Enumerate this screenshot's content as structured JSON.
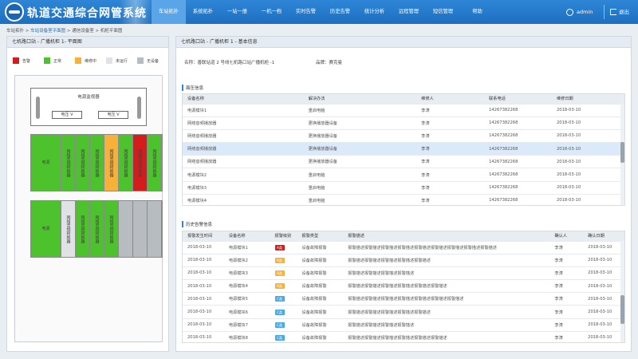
{
  "app": {
    "title": "轨道交通综合网管系统"
  },
  "nav": {
    "items": [
      "车站拓扑",
      "系统拓扑",
      "一站一册",
      "一机一档",
      "实时告警",
      "历史告警",
      "统计分析",
      "远程管理",
      "短信管理",
      "帮助"
    ],
    "active": 0,
    "user": "admin",
    "logout": "退出"
  },
  "breadcrumb": {
    "a": "车站拓扑",
    "b": "车站设备室平面图",
    "c": "通信设备室",
    "d": "机柜平面图",
    "sep": " > "
  },
  "left": {
    "title": "七机路口站 - 广播机柜 1- 平面图",
    "legend": [
      {
        "label": "告警",
        "color": "#d31c1c"
      },
      {
        "label": "正常",
        "color": "#4cc22c"
      },
      {
        "label": "维修中",
        "color": "#f5b13a"
      },
      {
        "label": "未运行",
        "color": "#dfe3e6"
      },
      {
        "label": "无设备",
        "color": "#b7bcc1"
      }
    ],
    "ps": {
      "title": "电源监视器",
      "v1": "电压 V",
      "v2": "电压 V"
    },
    "row1": {
      "first": "电源",
      "cells": [
        {
          "t": "网络音频转换器",
          "c": "g"
        },
        {
          "t": "网络音频转换器",
          "c": "g"
        },
        {
          "t": "网络音频转换器",
          "c": "g"
        },
        {
          "t": "网络音频转换器",
          "c": "y"
        },
        {
          "t": "网络音频转换器",
          "c": "g"
        },
        {
          "t": "网络音频转换器",
          "c": "r"
        },
        {
          "t": "网络音频转换器",
          "c": "g"
        }
      ]
    },
    "row2": {
      "first": "电源",
      "cells": [
        {
          "t": "网络音频转换器",
          "c": "wht"
        },
        {
          "t": "网络音频转换器",
          "c": "g"
        },
        {
          "t": "网络音频转换器",
          "c": "g"
        },
        {
          "t": "网络音频转换器",
          "c": "g"
        },
        {
          "t": "",
          "c": "gy"
        },
        {
          "t": "",
          "c": "gy"
        },
        {
          "t": "",
          "c": "gy"
        }
      ]
    }
  },
  "right": {
    "title": "七机路口站 - 广播机柜 1 - 基本信息",
    "location": "名称：善联站道 2 号线七机路口站广播机柜 -1",
    "brand": "品牌：赛克曼",
    "maint": {
      "section": "面压信息",
      "headers": [
        "设备名称",
        "解决办法",
        "维修人",
        "联系电话",
        "维修日期"
      ],
      "rows": [
        [
          "电源模块1",
          "重启电脑",
          "李涛",
          "14267382268",
          "2018-03-10"
        ],
        [
          "网络音频播放器",
          "更换播放器设备",
          "李涛",
          "14267382268",
          "2018-03-10"
        ],
        [
          "网络音频播放器",
          "更换播放器设备",
          "李涛",
          "14267382268",
          "2018-03-10"
        ],
        [
          "网络音频播放器",
          "更换播放器设备",
          "李涛",
          "14267382268",
          "2018-03-10"
        ],
        [
          "网络音频播放器",
          "更换播放器设备",
          "李涛",
          "14267382268",
          "2018-03-10"
        ],
        [
          "电源模块2",
          "重启电脑",
          "李涛",
          "14267382268",
          "2018-03-10"
        ],
        [
          "电源模块3",
          "重启电脑",
          "李涛",
          "14267382268",
          "2018-03-10"
        ],
        [
          "电源模块4",
          "重启电脑",
          "李涛",
          "14267382268",
          "2018-03-10"
        ]
      ]
    },
    "alarm": {
      "section": "历史告警信息",
      "headers": [
        "报警发生时间",
        "设备名称",
        "报警级别",
        "报警类型",
        "报警描述",
        "确认人",
        "确认日期"
      ],
      "rows": [
        [
          "2018-03-10",
          "电源模块1",
          "A类",
          "设备故障报警",
          "报警描述报警描述报警描述报警描述报警描述报警描述报警描述报警描述报警描述",
          "李涛",
          "2018-03-10"
        ],
        [
          "2018-03-10",
          "电源模块2",
          "B类",
          "设备故障报警",
          "报警描述报警描述报警描述报警描述报警描述",
          "李涛",
          "2018-03-10"
        ],
        [
          "2018-03-10",
          "电源模块3",
          "B类",
          "设备故障报警",
          "报警描述报警描述报警描述报警描述",
          "李涛",
          "2018-03-10"
        ],
        [
          "2018-03-10",
          "电源模块4",
          "B类",
          "设备故障报警",
          "报警描述报警描述报警描述报警描述报警描述报警描述",
          "李涛",
          "2018-03-10"
        ],
        [
          "2018-03-10",
          "电源模块5",
          "C类",
          "设备故障报警",
          "报警描述报警描述报警描述报警描述报警描述报警描述报警描述",
          "李涛",
          "2018-03-10"
        ],
        [
          "2018-03-10",
          "电源模块6",
          "C类",
          "设备故障报警",
          "报警描述报警描述报警描述报警描述报警描述",
          "李涛",
          "2018-03-10"
        ],
        [
          "2018-03-10",
          "电源模块7",
          "C类",
          "设备故障报警",
          "报警描述报警描述报警描述报警描述",
          "李涛",
          "2018-03-10"
        ],
        [
          "2018-03-10",
          "电源模块8",
          "C类",
          "设备故障报警",
          "报警描述报警描述报警描述报警描述报警描述报警描述",
          "李涛",
          "2018-03-10"
        ]
      ]
    }
  }
}
